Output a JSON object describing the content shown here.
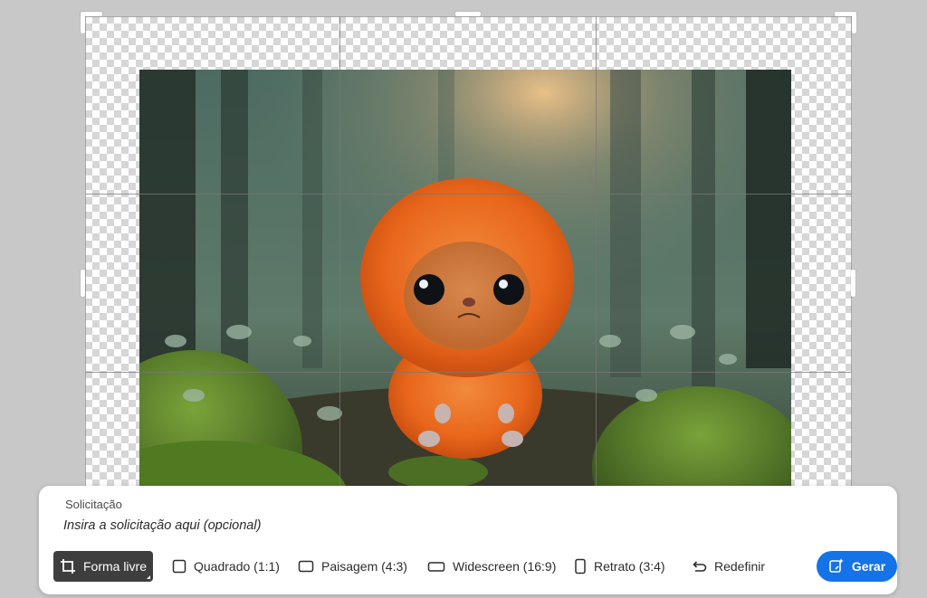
{
  "prompt": {
    "label": "Solicitação",
    "placeholder": "Insira a solicitação aqui (opcional)"
  },
  "toolbar": {
    "options": [
      {
        "label": "Forma livre",
        "icon": "crop-icon",
        "selected": true
      },
      {
        "label": "Quadrado (1:1)",
        "icon": "square-icon",
        "selected": false
      },
      {
        "label": "Paisagem (4:3)",
        "icon": "landscape-rect-icon",
        "selected": false
      },
      {
        "label": "Widescreen (16:9)",
        "icon": "widescreen-rect-icon",
        "selected": false
      },
      {
        "label": "Retrato (3:4)",
        "icon": "portrait-rect-icon",
        "selected": false
      }
    ],
    "reset_label": "Redefinir",
    "reset_icon": "reset-icon",
    "generate_label": "Gerar",
    "generate_icon": "generative-expand-icon"
  },
  "colors": {
    "accent": "#1473e6",
    "selected_bg": "#3e3e3e",
    "canvas_bg": "#c8c8c8"
  },
  "image": {
    "subject": "fluffy orange creature in a misty forest"
  }
}
